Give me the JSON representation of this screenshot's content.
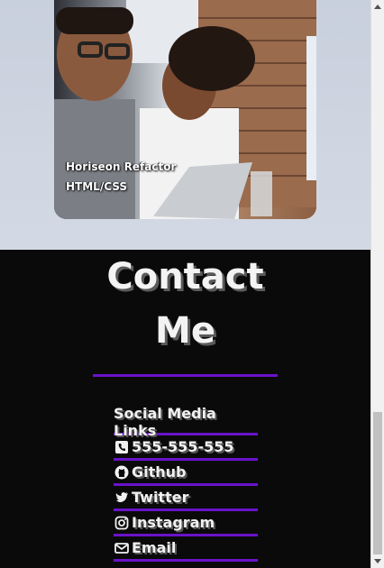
{
  "project": {
    "title": "Horiseon Refactor",
    "subtitle": "HTML/CSS"
  },
  "contact": {
    "heading_line1": "Contact",
    "heading_line2": "Me",
    "accent_color": "#6a12c9"
  },
  "social": {
    "header": "Social Media Links",
    "links": [
      {
        "label": "555-555-555",
        "icon": "phone-icon"
      },
      {
        "label": "Github",
        "icon": "github-icon"
      },
      {
        "label": "Twitter",
        "icon": "twitter-icon"
      },
      {
        "label": "Instagram",
        "icon": "instagram-icon"
      },
      {
        "label": "Email",
        "icon": "email-icon"
      }
    ]
  }
}
